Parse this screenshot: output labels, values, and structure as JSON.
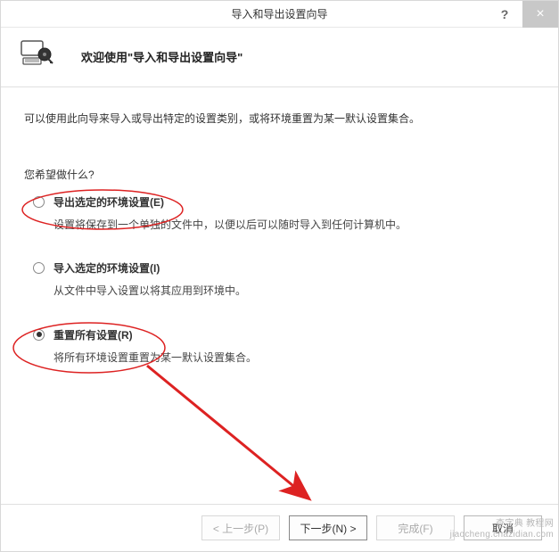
{
  "titlebar": {
    "title": "导入和导出设置向导",
    "help": "?",
    "close": "×"
  },
  "header": {
    "title": "欢迎使用\"导入和导出设置向导\""
  },
  "content": {
    "description": "可以使用此向导来导入或导出特定的设置类别，或将环境重置为某一默认设置集合。",
    "prompt": "您希望做什么?"
  },
  "options": [
    {
      "label": "导出选定的环境设置(E)",
      "desc": "设置将保存到一个单独的文件中，以便以后可以随时导入到任何计算机中。",
      "selected": false
    },
    {
      "label": "导入选定的环境设置(I)",
      "desc": "从文件中导入设置以将其应用到环境中。",
      "selected": false
    },
    {
      "label": "重置所有设置(R)",
      "desc": "将所有环境设置重置为某一默认设置集合。",
      "selected": true
    }
  ],
  "footer": {
    "prev": "< 上一步(P)",
    "next": "下一步(N) >",
    "finish": "完成(F)",
    "cancel": "取消"
  },
  "watermark": {
    "line1": "查字典 教程网",
    "line2": "jiaocheng.chazidian.com"
  }
}
